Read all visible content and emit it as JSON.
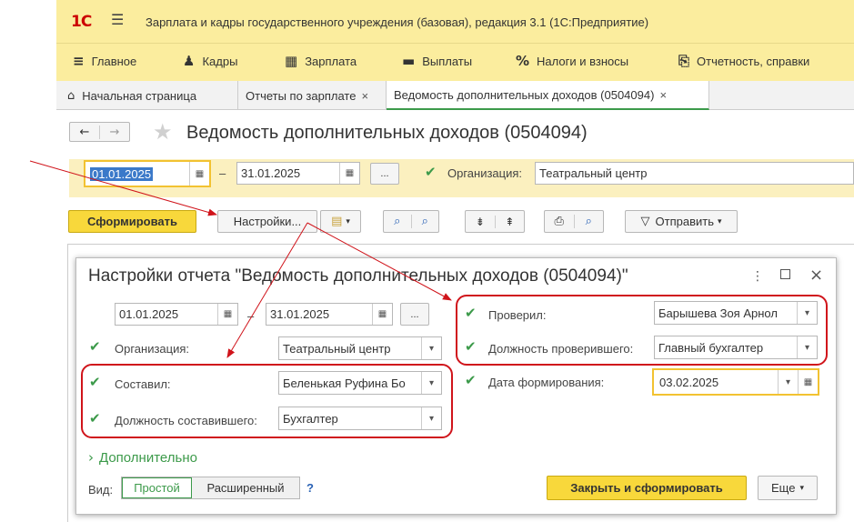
{
  "app": {
    "logo": "1С",
    "title": "Зарплата и кадры государственного учреждения (базовая), редакция 3.1  (1С:Предприятие)"
  },
  "sections": [
    {
      "icon": "≡",
      "label": "Главное"
    },
    {
      "icon": "♟",
      "label": "Кадры"
    },
    {
      "icon": "▦",
      "label": "Зарплата"
    },
    {
      "icon": "▬",
      "label": "Выплаты"
    },
    {
      "icon": "%",
      "label": "Налоги и взносы"
    },
    {
      "icon": "⎘",
      "label": "Отчетность, справки"
    }
  ],
  "tabs": [
    {
      "label": "Начальная страница",
      "icon": "home-icon"
    },
    {
      "label": "Отчеты по зарплате"
    },
    {
      "label": "Ведомость дополнительных доходов (0504094)"
    }
  ],
  "page": {
    "title": "Ведомость дополнительных доходов (0504094)"
  },
  "filters": {
    "date_from": "01.01.2025",
    "dash": "–",
    "date_to": "31.01.2025",
    "dots": "...",
    "org_label": "Организация:",
    "org_value": "Театральный центр"
  },
  "toolbar": {
    "generate": "Сформировать",
    "settings": "Настройки...",
    "send": "Отправить"
  },
  "dialog": {
    "title": "Настройки отчета \"Ведомость дополнительных доходов (0504094)\"",
    "date_from": "01.01.2025",
    "dash": "–",
    "date_to": "31.01.2025",
    "dots": "...",
    "org_label": "Организация:",
    "org_value": "Театральный центр",
    "compiled_label": "Составил:",
    "compiled_value": "Беленькая Руфина Бо",
    "compiled_pos_label": "Должность составившего:",
    "compiled_pos_value": "Бухгалтер",
    "checked_label": "Проверил:",
    "checked_value": "Барышева Зоя Арнол",
    "checked_pos_label": "Должность проверившего:",
    "checked_pos_value": "Главный бухгалтер",
    "date_gen_label": "Дата формирования:",
    "date_gen_value": "03.02.2025",
    "extra": "Дополнительно",
    "view_label": "Вид:",
    "view_simple": "Простой",
    "view_ext": "Расширенный",
    "help": "?",
    "close_generate": "Закрыть и сформировать",
    "more": "Еще"
  }
}
